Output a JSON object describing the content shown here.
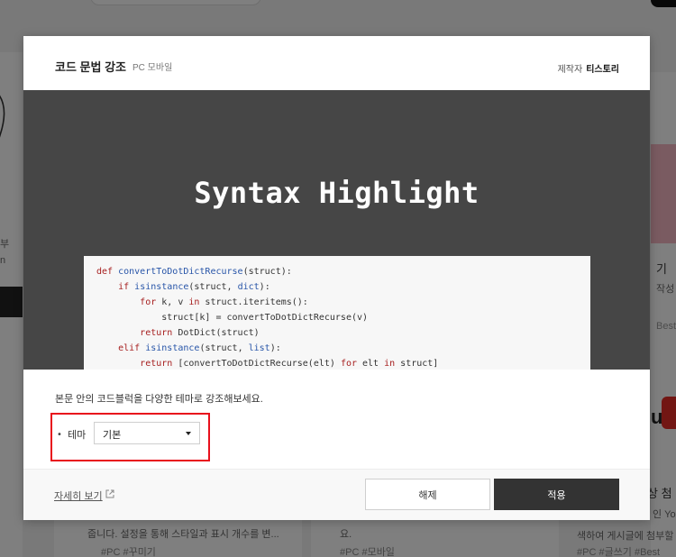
{
  "background": {
    "left_text_1": "부",
    "left_text_2": "n",
    "right_text_1": "기",
    "right_text_2": "작성",
    "right_text_3": "Best",
    "right_text_4": "상 첨",
    "right_text_5": "인 Yo",
    "right_text_6": "색하여 게시글에 첨부할 수",
    "right_text_7": "#PC   #글쓰기   #Best",
    "mid_text_1": "줍니다. 설정을 통해 스타일과 표시 개수를 변...",
    "mid_tags_1": "#PC   #꾸미기",
    "mid_text_2": "요.",
    "mid_tags_2": "#PC   #모바일"
  },
  "modal": {
    "title": "코드 문법 강조",
    "platform": "PC 모바일",
    "maker_label": "제작자",
    "maker_name": "티스토리",
    "preview_title": "Syntax Highlight",
    "description": "본문 안의 코드블럭을 다양한 테마로 강조해보세요.",
    "theme_label": "테마",
    "theme_value": "기본",
    "more_link": "자세히 보기",
    "cancel_button": "해제",
    "apply_button": "적용"
  },
  "code_lines": [
    "def convertToDotDictRecurse(struct):",
    "    if isinstance(struct, dict):",
    "        for k, v in struct.iteritems():",
    "            struct[k] = convertToDotDictRecurse(v)",
    "        return DotDict(struct)",
    "    elif isinstance(struct, list):",
    "        return [convertToDotDictRecurse(elt) for elt in struct]"
  ],
  "colors": {
    "preview_bg": "#464646",
    "apply_bg": "#333333",
    "highlight_border": "#e8101c",
    "keyword": "#a72020",
    "function": "#2855a8"
  },
  "icons": {
    "external_link": "external-link-icon",
    "dropdown": "chevron-down-icon"
  }
}
